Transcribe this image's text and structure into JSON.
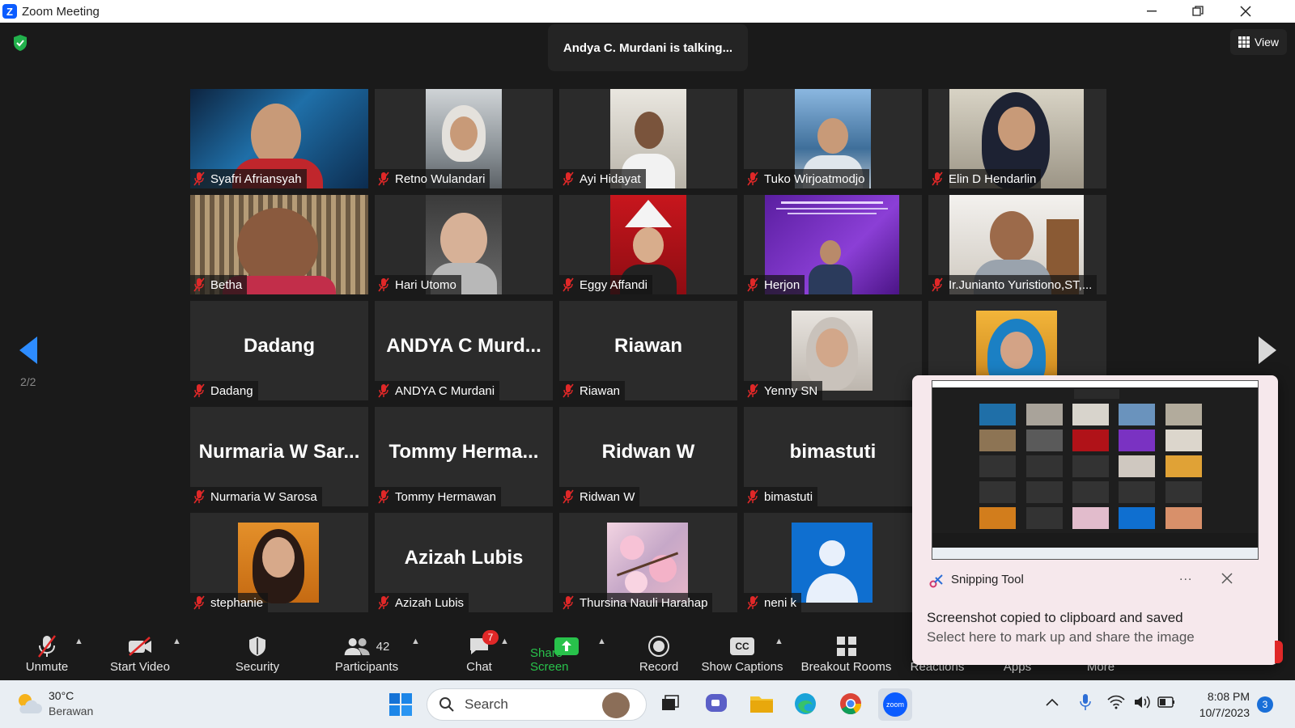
{
  "window": {
    "app_name": "Zoom Meeting"
  },
  "meeting": {
    "talking_banner": "Andya C. Murdani is talking...",
    "view_label": "View",
    "page_indicator": "2/2"
  },
  "participants": [
    {
      "name": "Syafri Afriansyah",
      "display": "video"
    },
    {
      "name": "Retno Wulandari",
      "display": "video"
    },
    {
      "name": "Ayi Hidayat",
      "display": "video"
    },
    {
      "name": "Tuko Wirjoatmodjo",
      "display": "video"
    },
    {
      "name": "Elin D Hendarlin",
      "display": "video"
    },
    {
      "name": "Betha",
      "display": "video"
    },
    {
      "name": "Hari Utomo",
      "display": "video"
    },
    {
      "name": "Eggy Affandi",
      "display": "video"
    },
    {
      "name": "Herjon",
      "display": "video"
    },
    {
      "name": "Ir.Junianto Yuristiono,ST,...",
      "display": "video"
    },
    {
      "name": "Dadang",
      "big": "Dadang",
      "display": "name"
    },
    {
      "name": "ANDYA C Murdani",
      "big": "ANDYA C Murd...",
      "display": "name"
    },
    {
      "name": "Riawan",
      "big": "Riawan",
      "display": "name"
    },
    {
      "name": "Yenny SN",
      "display": "video"
    },
    {
      "name": "",
      "display": "video"
    },
    {
      "name": "Nurmaria W Sarosa",
      "big": "Nurmaria W Sar...",
      "display": "name"
    },
    {
      "name": "Tommy Hermawan",
      "big": "Tommy Herma...",
      "display": "name"
    },
    {
      "name": "Ridwan W",
      "big": "Ridwan W",
      "display": "name"
    },
    {
      "name": "bimastuti",
      "big": "bimastuti",
      "display": "name"
    },
    {
      "name": "stephanie",
      "display": "video"
    },
    {
      "name": "Azizah Lubis",
      "big": "Azizah Lubis",
      "display": "name"
    },
    {
      "name": "Thursina Nauli Harahap",
      "display": "video"
    },
    {
      "name": "neni k",
      "display": "avatar"
    }
  ],
  "toolbar": {
    "unmute": "Unmute",
    "start_video": "Start Video",
    "security": "Security",
    "participants": "Participants",
    "participants_count": "42",
    "chat": "Chat",
    "chat_badge": "7",
    "share_screen": "Share Screen",
    "record": "Record",
    "show_captions": "Show Captions",
    "captions_icon_text": "CC",
    "breakout_rooms": "Breakout Rooms",
    "reactions": "Reactions",
    "apps": "Apps",
    "more": "More"
  },
  "toast": {
    "app_name": "Snipping Tool",
    "menu": "...",
    "title": "Screenshot copied to clipboard and saved",
    "subtitle": "Select here to mark up and share the image"
  },
  "taskbar": {
    "weather_temp": "30°C",
    "weather_desc": "Berawan",
    "search_placeholder": "Search",
    "time": "8:08 PM",
    "date": "10/7/2023",
    "notification_count": "3",
    "zoom_icon_text": "zoom"
  },
  "colors": {
    "zoom_blue": "#0b5cff",
    "share_green": "#28c24b",
    "mute_red": "#e02828",
    "nav_arrow": "#2d8cff",
    "badge_red": "#e02828"
  }
}
